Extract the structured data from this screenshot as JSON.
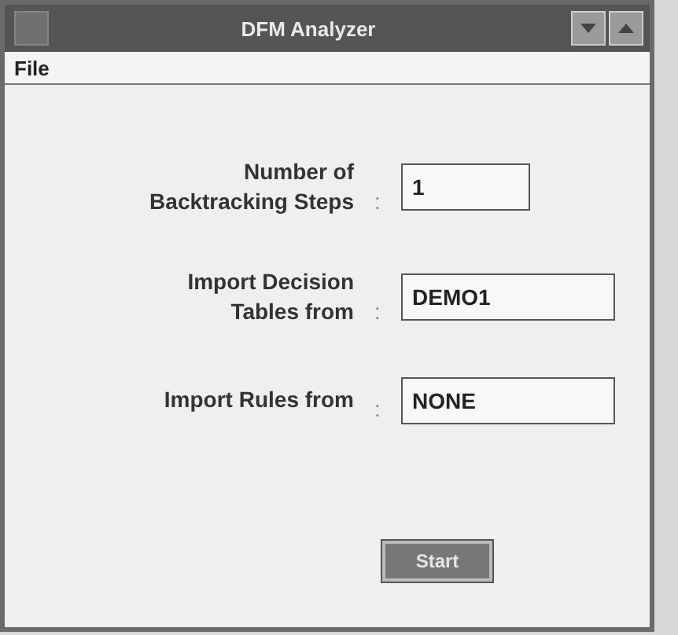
{
  "window": {
    "title": "DFM Analyzer"
  },
  "menu": [
    "File"
  ],
  "fields": [
    {
      "label": "Number of Backtracking Steps",
      "separator": ":",
      "value": "1"
    },
    {
      "label": "Import Decision Tables from",
      "separator": ":",
      "value": "DEMO1"
    },
    {
      "label": "Import Rules from",
      "separator": ":",
      "value": "NONE"
    }
  ],
  "button": {
    "label": "Start"
  }
}
